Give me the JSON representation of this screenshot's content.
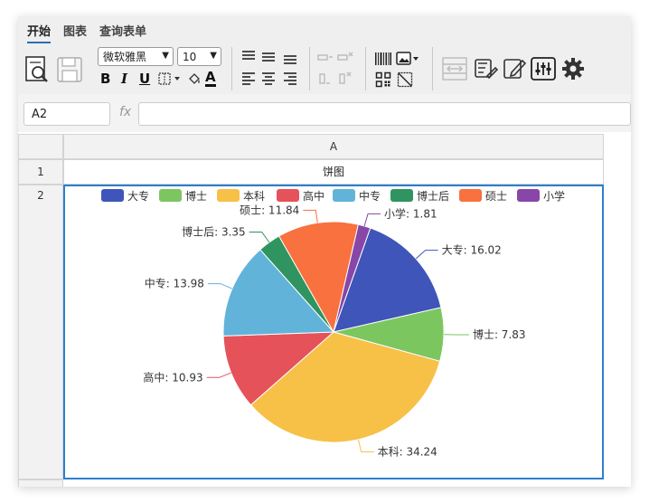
{
  "tabs": [
    "开始",
    "图表",
    "查询表单"
  ],
  "toolbar": {
    "font_name": "微软雅黑",
    "font_size": "10",
    "bold": "B",
    "italic": "I",
    "underline": "U",
    "font_color_glyph": "A"
  },
  "formula_bar": {
    "cell_ref": "A2",
    "fx_label": "fx",
    "value": ""
  },
  "sheet": {
    "column_header": "A",
    "row_headers": [
      "1",
      "2"
    ],
    "cell_a1": "饼图"
  },
  "chart_data": {
    "type": "pie",
    "title": "",
    "legend_position": "top",
    "slices": [
      {
        "name": "大专",
        "value": 16.02,
        "label": "大专: 16.02",
        "color": "#3f55b9"
      },
      {
        "name": "博士",
        "value": 7.83,
        "label": "博士: 7.83",
        "color": "#7cc660"
      },
      {
        "name": "本科",
        "value": 34.24,
        "label": "本科: 34.24",
        "color": "#f7c047"
      },
      {
        "name": "高中",
        "value": 10.93,
        "label": "高中: 10.93",
        "color": "#e5525a"
      },
      {
        "name": "中专",
        "value": 13.98,
        "label": "中专: 13.98",
        "color": "#62b3da"
      },
      {
        "name": "博士后",
        "value": 3.35,
        "label": "博士后: 3.35",
        "color": "#2f9460"
      },
      {
        "name": "硕士",
        "value": 11.84,
        "label": "硕士: 11.84",
        "color": "#f8713e"
      },
      {
        "name": "小学",
        "value": 1.81,
        "label": "小学: 1.81",
        "color": "#8746a8"
      }
    ]
  }
}
